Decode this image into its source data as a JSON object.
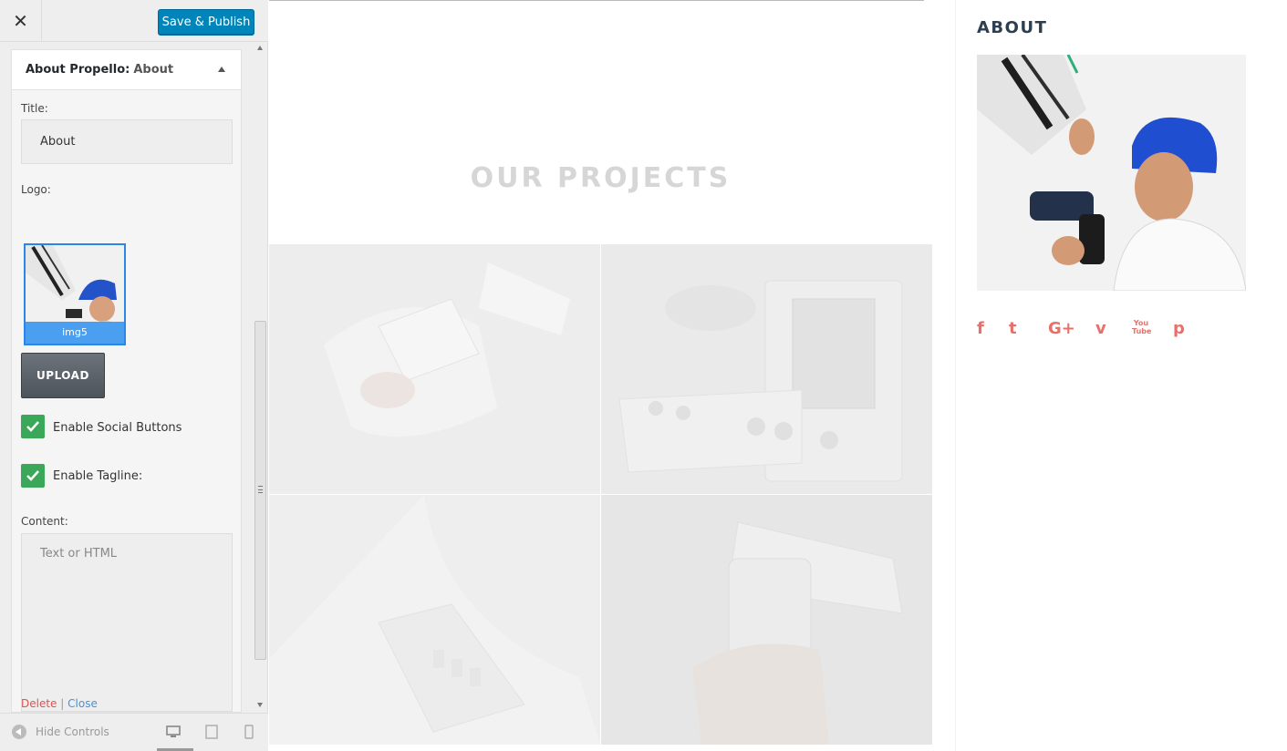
{
  "topbar": {
    "close_icon": "close-icon",
    "publish_label": "Save & Publish"
  },
  "widget": {
    "title_prefix": "About Propello:",
    "title_suffix": "About",
    "title_label": "Title:",
    "title_value": "About",
    "logo_label": "Logo:",
    "logo_caption": "img5",
    "upload_label": "UPLOAD",
    "social_label": "Enable Social Buttons",
    "tagline_label": "Enable Tagline:",
    "content_label": "Content:",
    "content_placeholder": "Text or HTML",
    "delete_label": "Delete",
    "separator": "|",
    "close_label": "Close"
  },
  "footer": {
    "hide_controls": "Hide Controls"
  },
  "preview": {
    "projects_title": "OUR PROJECTS",
    "about_title": "ABOUT",
    "social_icons": [
      {
        "name": "facebook-icon",
        "glyph": "f"
      },
      {
        "name": "twitter-icon",
        "glyph": "t"
      },
      {
        "name": "google-plus-icon",
        "glyph": "G+"
      },
      {
        "name": "vimeo-icon",
        "glyph": "v"
      },
      {
        "name": "youtube-icon",
        "glyph": "You Tube"
      },
      {
        "name": "pinterest-icon",
        "glyph": "p"
      }
    ]
  },
  "colors": {
    "accent": "#0085ba",
    "check": "#3aa858",
    "social": "#e8706a"
  }
}
